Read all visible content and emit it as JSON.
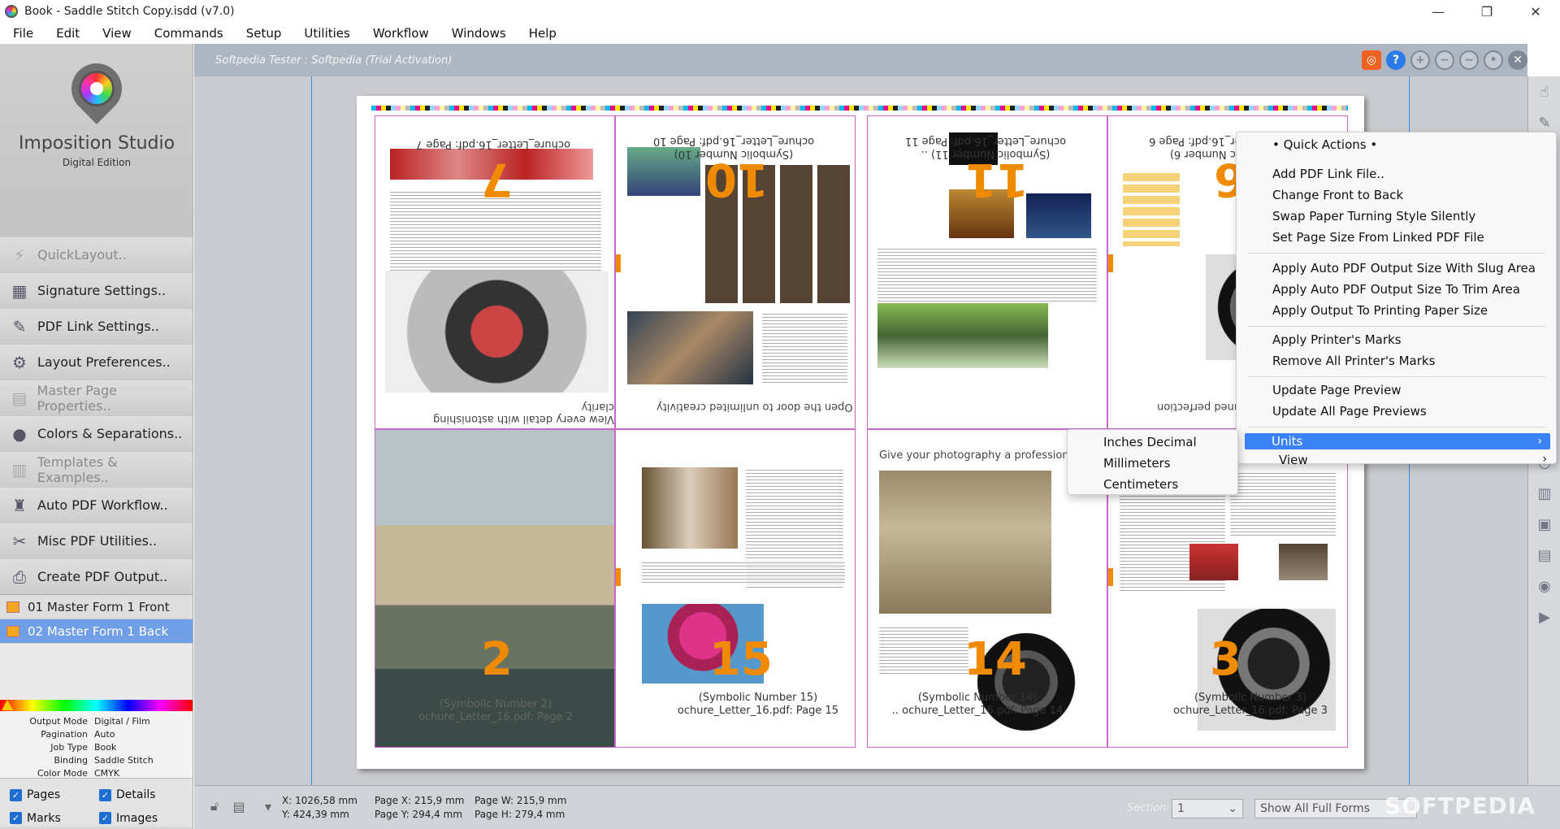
{
  "window": {
    "title": "Book - Saddle Stitch Copy.isdd (v7.0)",
    "minimize": "—",
    "maximize": "❐",
    "close": "✕"
  },
  "menubar": [
    "File",
    "Edit",
    "View",
    "Commands",
    "Setup",
    "Utilities",
    "Workflow",
    "Windows",
    "Help"
  ],
  "logo": {
    "name": "Imposition Studio",
    "edition": "Digital Edition"
  },
  "sidebar": {
    "items": [
      {
        "label": "QuickLayout..",
        "icon": "lightning-icon",
        "glyph": "⚡",
        "disabled": true
      },
      {
        "label": "Signature Settings..",
        "icon": "grid-icon",
        "glyph": "▦",
        "disabled": false
      },
      {
        "label": "PDF Link Settings..",
        "icon": "pdf-icon",
        "glyph": "✎",
        "disabled": false
      },
      {
        "label": "Layout Preferences..",
        "icon": "gear-icon",
        "glyph": "⚙",
        "disabled": false
      },
      {
        "label": "Master Page Properties..",
        "icon": "master-page-icon",
        "glyph": "▤",
        "disabled": true
      },
      {
        "label": "Colors & Separations..",
        "icon": "colors-icon",
        "glyph": "●",
        "disabled": false
      },
      {
        "label": "Templates & Examples..",
        "icon": "templates-icon",
        "glyph": "▥",
        "disabled": true
      },
      {
        "label": "Auto PDF Workflow..",
        "icon": "robot-icon",
        "glyph": "♜",
        "disabled": false
      },
      {
        "label": "Misc PDF Utilities..",
        "icon": "utilities-icon",
        "glyph": "✂",
        "disabled": false
      },
      {
        "label": "Create PDF Output..",
        "icon": "printer-icon",
        "glyph": "⎙",
        "disabled": false
      }
    ],
    "forms": [
      {
        "label": "01 Master Form 1 Front",
        "selected": false
      },
      {
        "label": "02 Master Form 1 Back",
        "selected": true
      }
    ],
    "properties": [
      {
        "key": "Output Mode",
        "value": "Digital / Film"
      },
      {
        "key": "Pagination",
        "value": "Auto"
      },
      {
        "key": "Job Type",
        "value": "Book"
      },
      {
        "key": "Binding",
        "value": "Saddle Stitch"
      },
      {
        "key": "Color Mode",
        "value": "CMYK"
      }
    ],
    "checks": [
      {
        "label": "Pages",
        "checked": true
      },
      {
        "label": "Details",
        "checked": true
      },
      {
        "label": "Marks",
        "checked": true
      },
      {
        "label": "Images",
        "checked": true
      }
    ]
  },
  "workspace": {
    "license": "Softpedia Tester : Softpedia (Trial Activation)",
    "pages": {
      "p7": {
        "number": "7",
        "info": "ochure_Letter_16.pdf: Page 7",
        "tagline": "View every detail with astonishing clarity"
      },
      "p10": {
        "number": "10",
        "info": "(Symbolic Number 10) ochure_Letter_16.pdf: Page 10",
        "tagline": "Open the door to unlimited creativity"
      },
      "p11": {
        "number": "11",
        "info": "(Symbolic Number 11) .. ochure_Letter_16.pdf: Page 11"
      },
      "p6": {
        "number": "6",
        "info": "(Symbolic Number 6) ochure_Letter_16.pdf: Page 6",
        "tagline": "-tuned perfection"
      },
      "p2": {
        "number": "2",
        "info": "(Symbolic Number 2) ochure_Letter_16.pdf: Page 2"
      },
      "p15": {
        "number": "15",
        "info1": "(Symbolic Number 15)",
        "info2": "ochure_Letter_16.pdf: Page 15"
      },
      "p14": {
        "number": "14",
        "info1": "(Symbolic Number 14)",
        "info2": ".. ochure_Letter_16.pdf: Page 14",
        "headline": "Give your photography a professional"
      },
      "p3": {
        "number": "3",
        "info1": "(Symbolic Number 3)",
        "info2": "ochure_Letter_16.pdf: Page 3"
      }
    }
  },
  "context_menu": {
    "title": "• Quick Actions •",
    "group1": [
      "Add PDF Link File..",
      "Change Front to Back",
      "Swap Paper Turning Style Silently",
      "Set Page Size From Linked PDF File"
    ],
    "group2": [
      "Apply Auto PDF Output Size With Slug Area",
      "Apply Auto PDF Output Size To Trim Area",
      "Apply Output To Printing Paper Size"
    ],
    "group3": [
      "Apply Printer's Marks",
      "Remove All Printer's Marks"
    ],
    "group4": [
      "Update Page Preview",
      "Update All Page Previews"
    ],
    "units": "Units",
    "view": "View",
    "submenu": [
      "Inches Decimal",
      "Millimeters",
      "Centimeters"
    ]
  },
  "status": {
    "x": "X: 1026,58 mm",
    "y": "Y: 424,39 mm",
    "page_x": "Page X: 215,9 mm",
    "page_y": "Page Y: 294,4 mm",
    "page_w": "Page W: 215,9 mm",
    "page_h": "Page H: 279,4 mm",
    "section_label": "Section:",
    "section_value": "1",
    "forms_filter": "Show All Full Forms",
    "watermark": "SOFTPEDIA"
  }
}
